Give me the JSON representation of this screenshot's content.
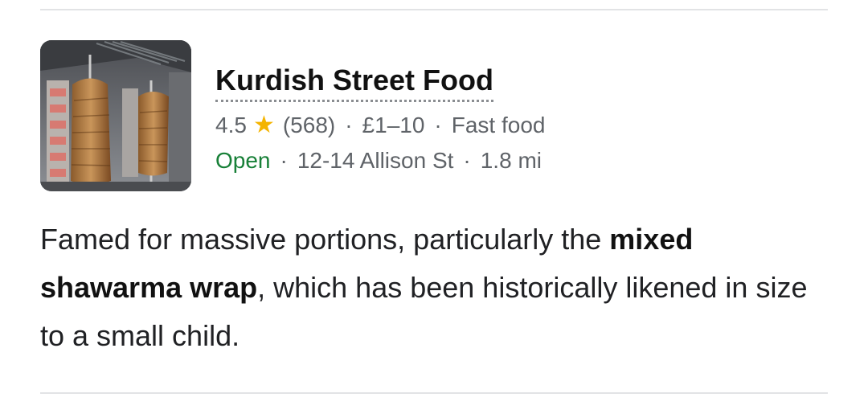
{
  "listing": {
    "name": "Kurdish Street Food",
    "rating": "4.5",
    "star_icon": "star-icon",
    "reviews": "(568)",
    "price": "£1–10",
    "category": "Fast food",
    "status": "Open",
    "address": "12-14 Allison St",
    "distance": "1.8 mi",
    "separator": "·",
    "colors": {
      "status_open": "#188038",
      "star": "#f4b400",
      "meta_text": "#5f6368"
    }
  },
  "description": {
    "part1": "Famed for massive portions, particularly the ",
    "bold1": "mixed shawarma wrap",
    "part2": ", which has been historically likened in size to a small child."
  },
  "thumbnail": {
    "icon": "shawarma-photo"
  }
}
